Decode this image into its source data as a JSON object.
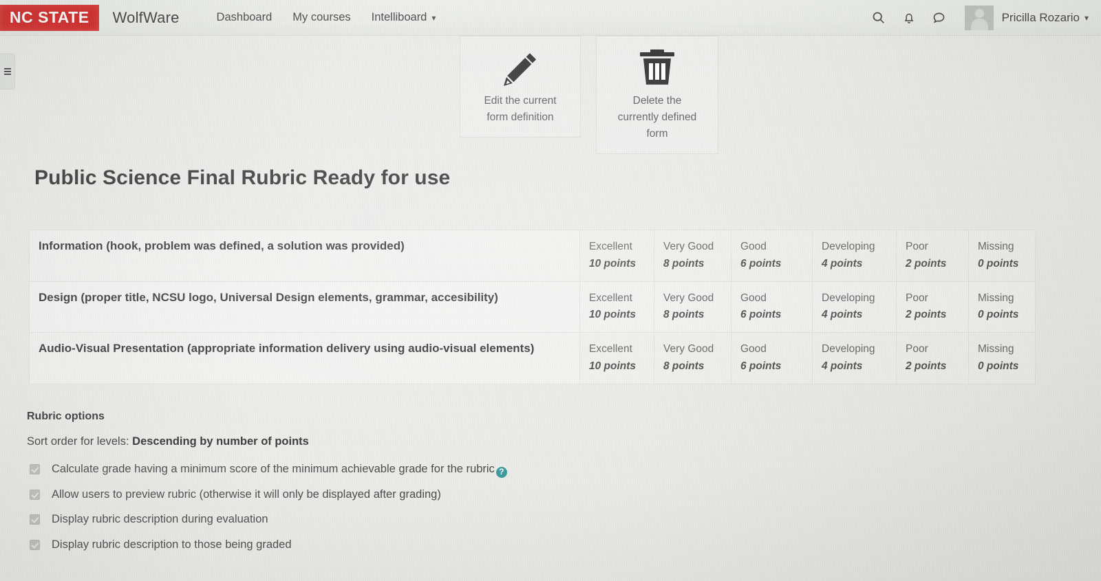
{
  "navbar": {
    "logo_text": "NC STATE",
    "logo_color": "#cc0000",
    "brand": "WolfWare",
    "links": [
      {
        "label": "Dashboard",
        "icon": ""
      },
      {
        "label": "My courses",
        "icon": ""
      },
      {
        "label": "Intelliboard",
        "icon": "chevron-down-icon"
      }
    ],
    "icons": [
      "search-icon",
      "bell-icon",
      "message-icon"
    ],
    "user_name": "Pricilla Rozario",
    "user_caret": "⌄"
  },
  "actions": [
    {
      "icon": "pencil-icon",
      "caption_line1": "Edit the current",
      "caption_line2": "form definition"
    },
    {
      "icon": "trash-icon",
      "caption_line1": "Delete the",
      "caption_line2": "currently defined",
      "caption_line3": "form"
    }
  ],
  "page_title": "Public Science Final Rubric Ready for use",
  "rubric": {
    "level_headers": [
      "Excellent",
      "Very Good",
      "Good",
      "Developing",
      "Poor",
      "Missing"
    ],
    "rows": [
      {
        "criterion": "Information (hook, problem was defined, a solution was provided)",
        "levels": [
          {
            "name": "Excellent",
            "points": "10 points"
          },
          {
            "name": "Very Good",
            "points": "8 points"
          },
          {
            "name": "Good",
            "points": "6 points"
          },
          {
            "name": "Developing",
            "points": "4 points"
          },
          {
            "name": "Poor",
            "points": "2 points"
          },
          {
            "name": "Missing",
            "points": "0 points"
          }
        ]
      },
      {
        "criterion": "Design (proper title, NCSU logo, Universal Design elements, grammar, accesibility)",
        "levels": [
          {
            "name": "Excellent",
            "points": "10 points"
          },
          {
            "name": "Very Good",
            "points": "8 points"
          },
          {
            "name": "Good",
            "points": "6 points"
          },
          {
            "name": "Developing",
            "points": "4 points"
          },
          {
            "name": "Poor",
            "points": "2 points"
          },
          {
            "name": "Missing",
            "points": "0 points"
          }
        ]
      },
      {
        "criterion": "Audio-Visual Presentation (appropriate information delivery using audio-visual elements)",
        "levels": [
          {
            "name": "Excellent",
            "points": "10 points"
          },
          {
            "name": "Very Good",
            "points": "8 points"
          },
          {
            "name": "Good",
            "points": "6 points"
          },
          {
            "name": "Developing",
            "points": "4 points"
          },
          {
            "name": "Poor",
            "points": "2 points"
          },
          {
            "name": "Missing",
            "points": "0 points"
          }
        ]
      }
    ]
  },
  "options": {
    "heading": "Rubric options",
    "sort_order_label": "Sort order for levels:",
    "sort_order_value": "Descending by number of points",
    "help_glyph": "?",
    "items": [
      {
        "label": "Calculate grade having a minimum score of the minimum achievable grade for the rubric",
        "checked": true,
        "has_help": true
      },
      {
        "label": "Allow users to preview rubric (otherwise it will only be displayed after grading)",
        "checked": true,
        "has_help": false
      },
      {
        "label": "Display rubric description during evaluation",
        "checked": true,
        "has_help": false
      },
      {
        "label": "Display rubric description to those being graded",
        "checked": true,
        "has_help": false
      }
    ]
  },
  "drawer_toggle": {
    "icon": "hamburger-icon"
  }
}
